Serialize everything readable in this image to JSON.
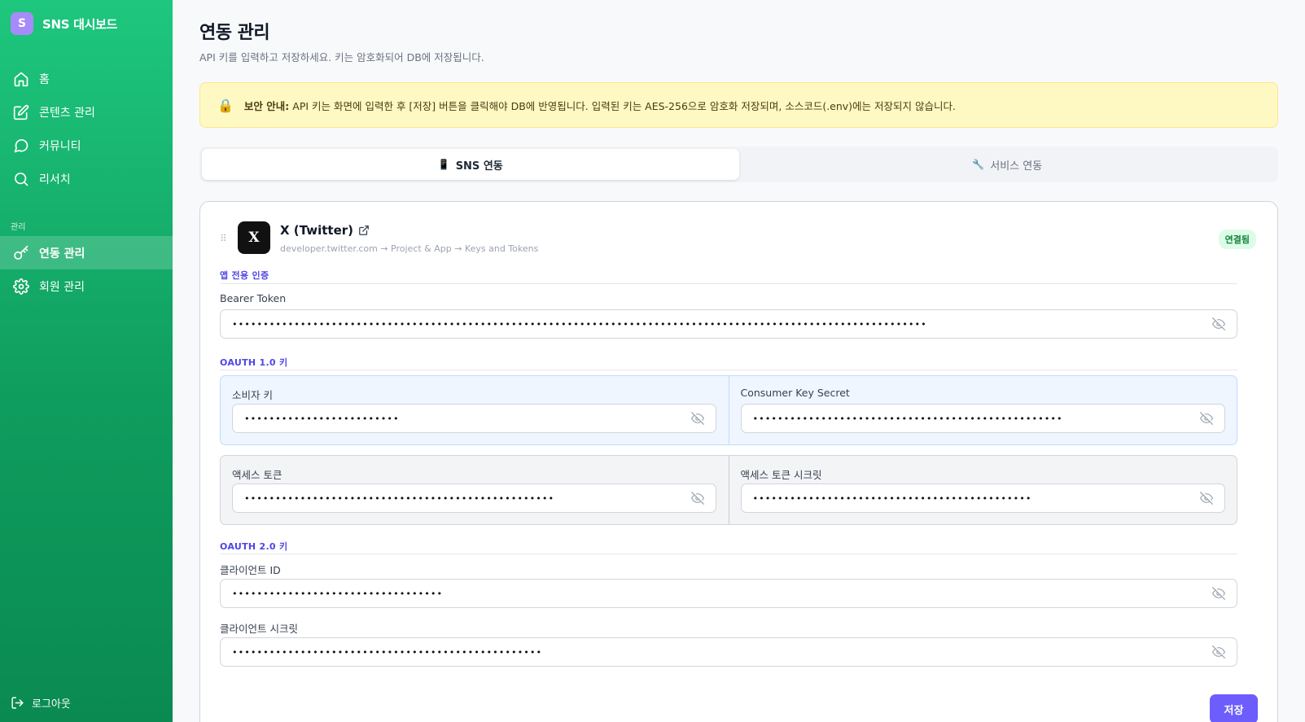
{
  "brand": {
    "logo_letter": "S",
    "title": "SNS 대시보드"
  },
  "sidebar": {
    "items": [
      {
        "label": "홈",
        "icon": "home-icon"
      },
      {
        "label": "콘텐츠 관리",
        "icon": "edit-icon"
      },
      {
        "label": "커뮤니티",
        "icon": "message-circle-icon"
      },
      {
        "label": "리서치",
        "icon": "search-icon"
      }
    ],
    "section_label": "관리",
    "admin_items": [
      {
        "label": "연동 관리",
        "icon": "key-icon",
        "active": true
      },
      {
        "label": "회원 관리",
        "icon": "gear-icon"
      }
    ],
    "logout_label": "로그아웃"
  },
  "page": {
    "title": "연동 관리",
    "subtitle": "API 키를 입력하고 저장하세요. 키는 암호화되어 DB에 저장됩니다."
  },
  "notice": {
    "icon": "🔒",
    "bold": "보안 안내:",
    "text": "API 키는 화면에 입력한 후 [저장] 버튼을 클릭해야 DB에 반영됩니다. 입력된 키는 AES-256으로 암호화 저장되며, 소스코드(.env)에는 저장되지 않습니다."
  },
  "tabs": [
    {
      "icon": "📱",
      "label": "SNS 연동",
      "active": true
    },
    {
      "icon": "🔧",
      "label": "서비스 연동",
      "active": false
    }
  ],
  "platform": {
    "drag_handle": "⠿",
    "logo": "X",
    "name": "X (Twitter)",
    "path": "developer.twitter.com → Project & App → Keys and Tokens",
    "status": "연결됨",
    "status_color": "#15803d"
  },
  "sections": {
    "app_auth": "앱 전용 인증",
    "oauth1": "OAUTH 1.0 키",
    "oauth2": "OAUTH 2.0 키"
  },
  "fields": {
    "bearer": {
      "label": "Bearer Token",
      "value": "••••••••••••••••••••••••••••••••••••••••••••••••••••••••••••••••••••••••••••••••••••••••••••••••••••••••••••••••"
    },
    "consumer_key": {
      "label": "소비자 키",
      "value": "•••••••••••••••••••••••••"
    },
    "consumer_secret": {
      "label": "Consumer Key Secret",
      "value": "••••••••••••••••••••••••••••••••••••••••••••••••••"
    },
    "access_token": {
      "label": "액세스 토큰",
      "value": "••••••••••••••••••••••••••••••••••••••••••••••••••"
    },
    "access_secret": {
      "label": "액세스 토큰 시크릿",
      "value": "•••••••••••••••••••••••••••••••••••••••••••••"
    },
    "client_id": {
      "label": "클라이언트 ID",
      "value": "••••••••••••••••••••••••••••••••••"
    },
    "client_secret": {
      "label": "클라이언트 시크릿",
      "value": "••••••••••••••••••••••••••••••••••••••••••••••••••"
    }
  },
  "save_label": "저장",
  "colors": {
    "accent": "#6d5dfc",
    "sidebar_green": "#12b06c",
    "notice_bg": "#fef9c3"
  }
}
